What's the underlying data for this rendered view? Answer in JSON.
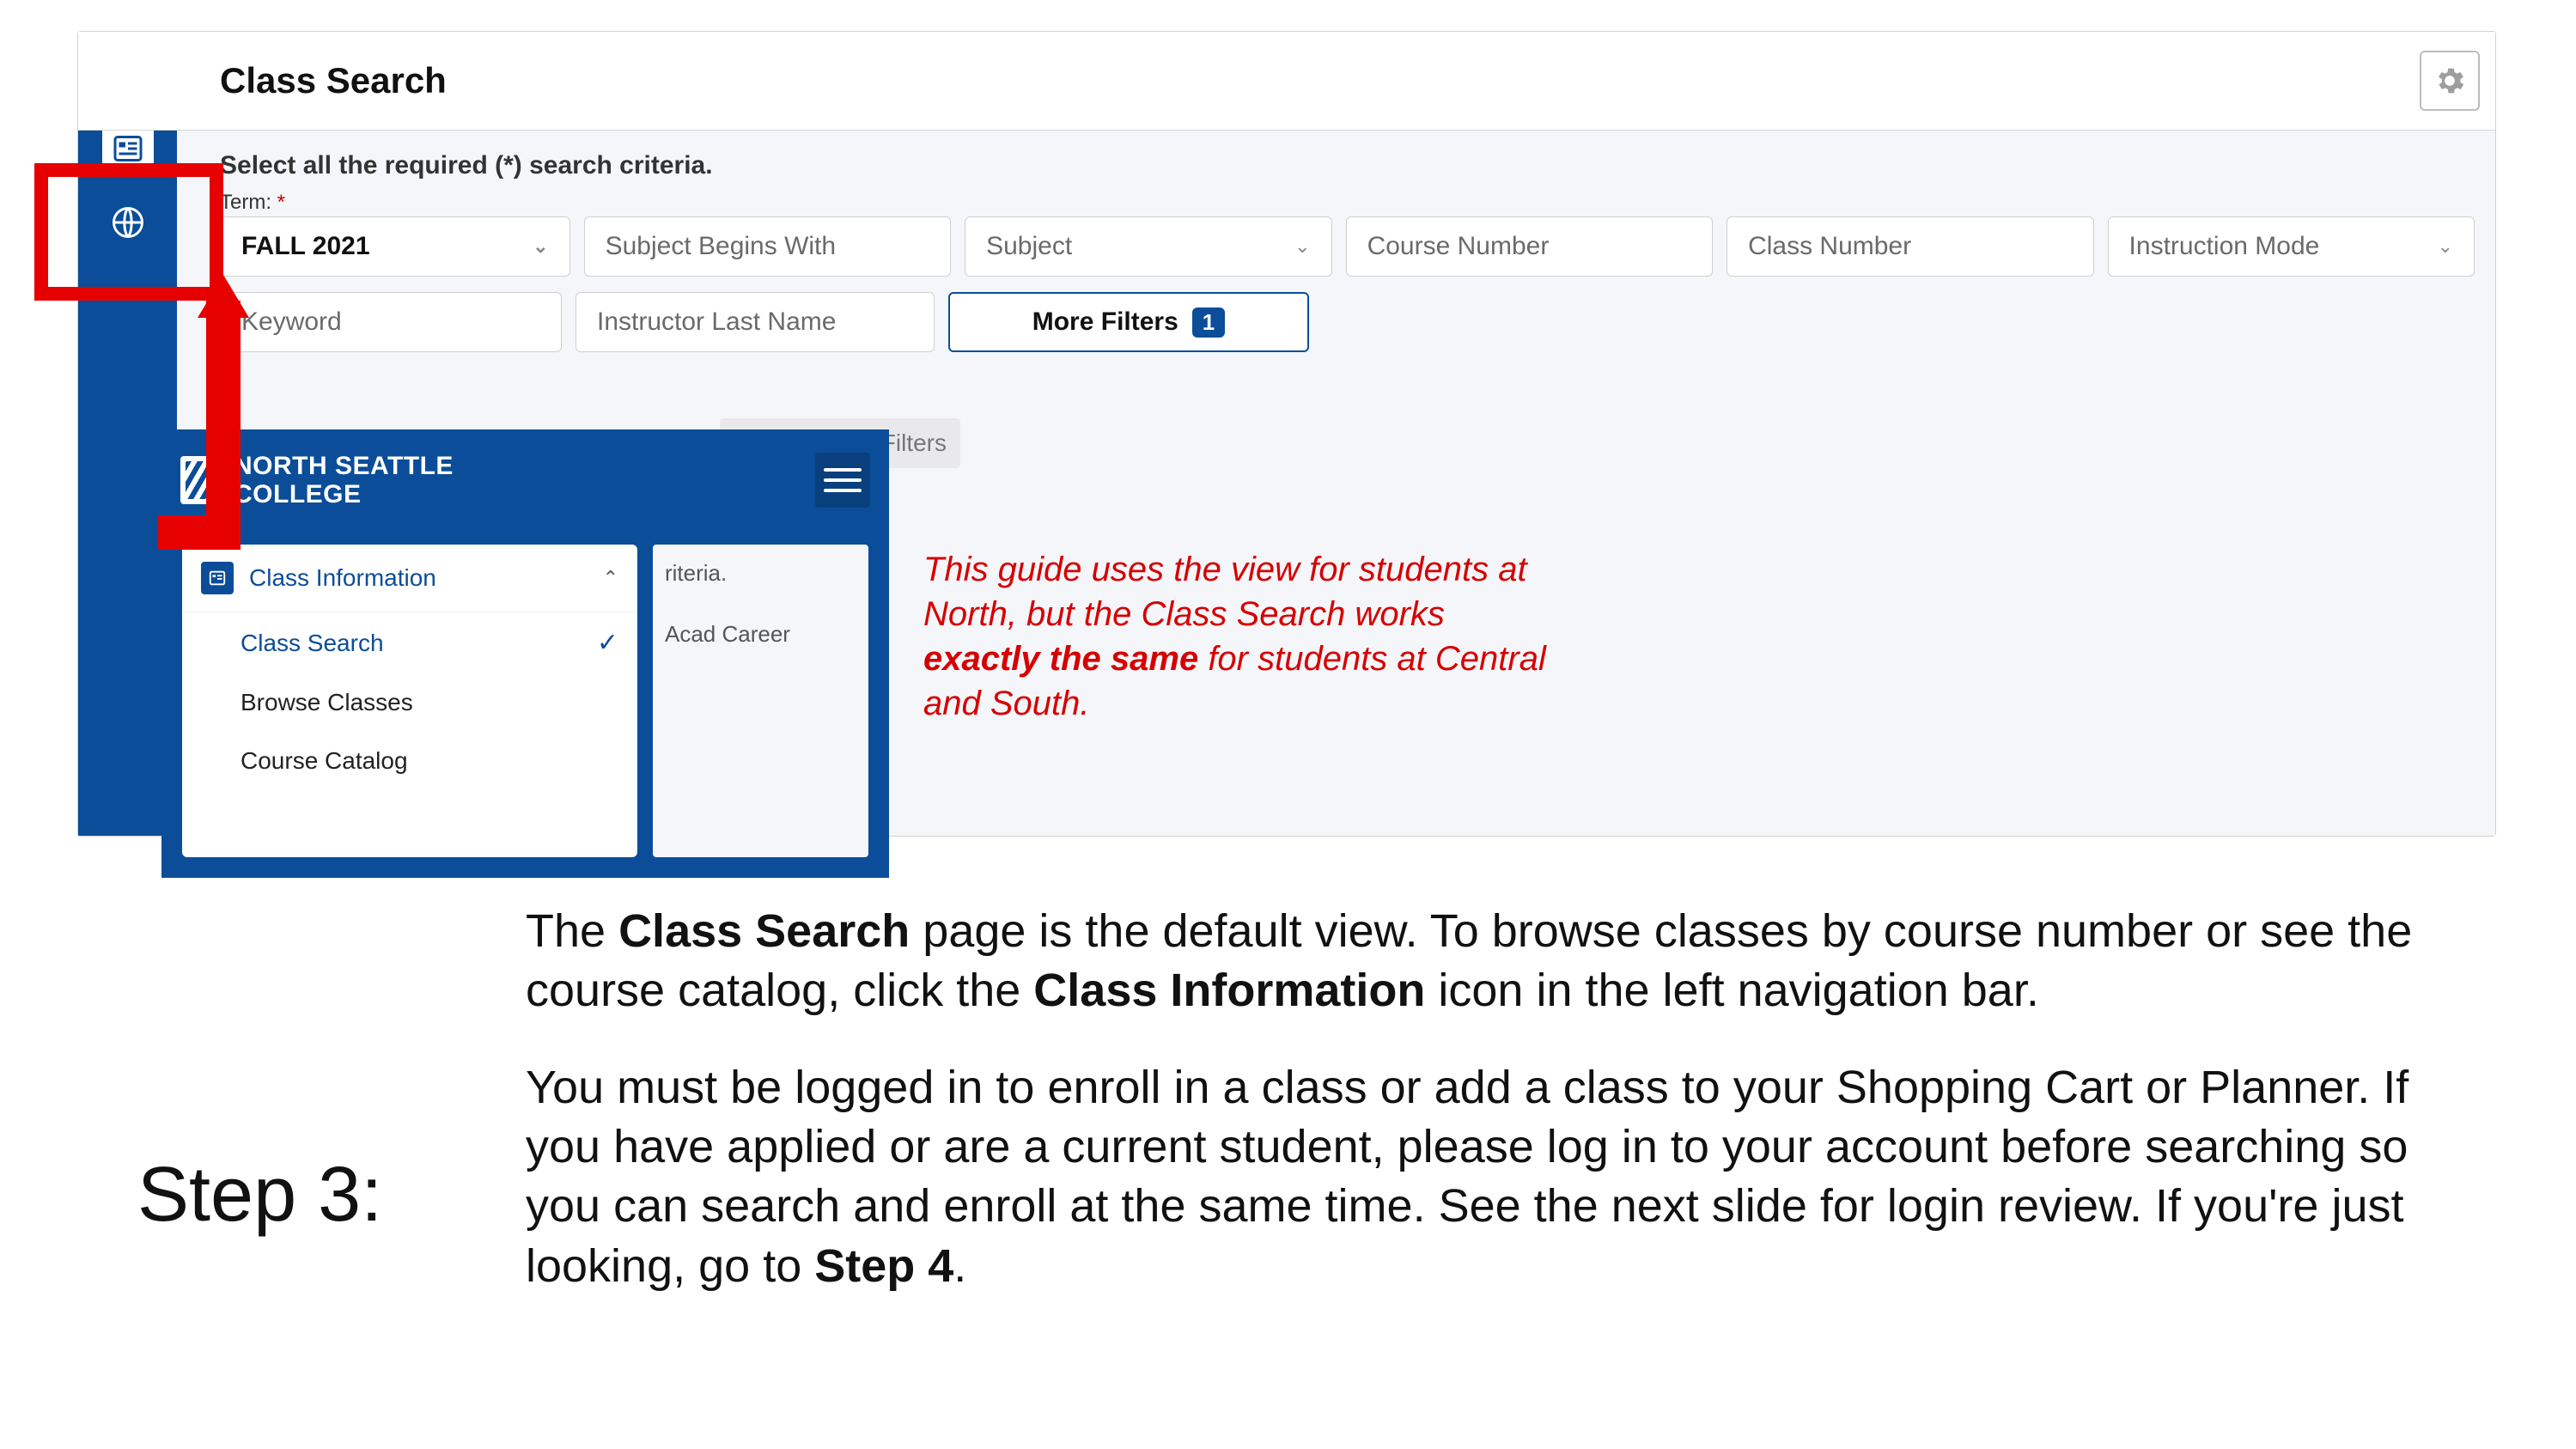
{
  "header": {
    "title": "Class Search"
  },
  "search": {
    "instruction": "Select all the required (*) search criteria.",
    "term_label": "Term:",
    "term_required_marker": "*",
    "term_value": "FALL 2021",
    "subject_begins_with": "Subject Begins With",
    "subject": "Subject",
    "course_number": "Course Number",
    "class_number": "Class Number",
    "instruction_mode": "Instruction Mode",
    "keyword": "Keyword",
    "instructor_last_name": "Instructor Last Name",
    "more_filters_label": "More Filters",
    "more_filters_count": "1",
    "reset_filters": "Reset Filters"
  },
  "popout": {
    "org_line1": "NORTH SEATTLE",
    "org_line2": "COLLEGE",
    "menu_header": "Class Information",
    "items": [
      {
        "label": "Class Search",
        "selected": true
      },
      {
        "label": "Browse Classes",
        "selected": false
      },
      {
        "label": "Course Catalog",
        "selected": false
      }
    ],
    "right_criteria": "riteria.",
    "right_acad": "Acad Career"
  },
  "red_note": {
    "line1": "This guide uses the view for students at",
    "line2": "North, but the Class Search works",
    "line3_bold": "exactly the same",
    "line3_rest": " for students at Central",
    "line4": "and South."
  },
  "step": {
    "label": "Step 3:",
    "p1_a": "The ",
    "p1_b": "Class Search",
    "p1_c": " page is the default view. To browse classes by course number or see the course catalog, click the ",
    "p1_d": "Class Information",
    "p1_e": " icon in the left navigation bar.",
    "p2_a": "You must be logged in to enroll in a class or add a class to your Shopping Cart or Planner. If you have applied or are a current student, please log in to your account before searching so you can search and enroll at the same time. See the next slide for login review. If you're just looking, go to ",
    "p2_b": "Step 4",
    "p2_c": "."
  }
}
